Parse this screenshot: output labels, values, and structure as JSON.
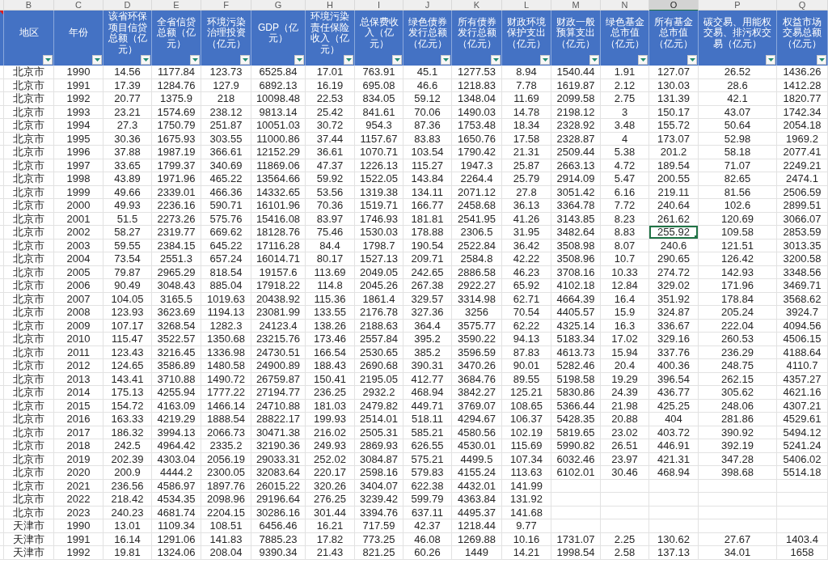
{
  "table": {
    "partial_column": {
      "comment": true
    },
    "columns": [
      {
        "letter": "B",
        "header": "地区",
        "selected": false
      },
      {
        "letter": "C",
        "header": "年份",
        "selected": false
      },
      {
        "letter": "D",
        "header": "该省环保项目信贷总额（亿元）",
        "selected": false
      },
      {
        "letter": "E",
        "header": "全省信贷总额（亿元）",
        "selected": false
      },
      {
        "letter": "F",
        "header": "环境污染治理投资（亿元）",
        "selected": false
      },
      {
        "letter": "G",
        "header": "GDP（亿元）",
        "selected": false
      },
      {
        "letter": "H",
        "header": "环境污染责任保险收入（亿元）",
        "selected": false
      },
      {
        "letter": "I",
        "header": "总保费收入（亿元）",
        "selected": false
      },
      {
        "letter": "J",
        "header": "绿色债券发行总额（亿元）",
        "selected": false
      },
      {
        "letter": "K",
        "header": "所有债券发行总额（亿元）",
        "selected": false
      },
      {
        "letter": "L",
        "header": "财政环境保护支出（亿元）",
        "selected": false
      },
      {
        "letter": "M",
        "header": "财政一般预算支出（亿元）",
        "selected": false
      },
      {
        "letter": "N",
        "header": "绿色基金总市值（亿元）",
        "selected": false
      },
      {
        "letter": "O",
        "header": "所有基金总市值（亿元）",
        "selected": true
      },
      {
        "letter": "P",
        "header": "碳交易、用能权交易、排污权交易（亿元）",
        "selected": false
      },
      {
        "letter": "Q",
        "header": "权益市场交易总额（亿元）",
        "selected": false
      }
    ],
    "rows": [
      {
        "selected": false,
        "cells": [
          "北京市",
          "1990",
          "14.56",
          "1177.84",
          "123.73",
          "6525.84",
          "17.01",
          "763.91",
          "45.1",
          "1277.53",
          "8.94",
          "1540.44",
          "1.91",
          "127.07",
          "26.52",
          "1436.26"
        ]
      },
      {
        "selected": false,
        "cells": [
          "北京市",
          "1991",
          "17.39",
          "1284.76",
          "127.9",
          "6892.13",
          "16.19",
          "695.08",
          "46.6",
          "1218.83",
          "7.78",
          "1619.87",
          "2.12",
          "130.03",
          "28.6",
          "1412.28"
        ]
      },
      {
        "selected": false,
        "cells": [
          "北京市",
          "1992",
          "20.77",
          "1375.9",
          "218",
          "10098.48",
          "22.53",
          "834.05",
          "59.12",
          "1348.04",
          "11.69",
          "2099.58",
          "2.75",
          "131.39",
          "42.1",
          "1820.77"
        ]
      },
      {
        "selected": false,
        "cells": [
          "北京市",
          "1993",
          "23.21",
          "1574.69",
          "238.12",
          "9813.14",
          "25.42",
          "841.61",
          "70.06",
          "1490.03",
          "14.78",
          "2198.12",
          "3",
          "150.17",
          "43.07",
          "1742.34"
        ]
      },
      {
        "selected": false,
        "cells": [
          "北京市",
          "1994",
          "27.3",
          "1750.79",
          "251.87",
          "10051.03",
          "30.72",
          "954.3",
          "87.36",
          "1753.48",
          "18.34",
          "2328.92",
          "3.48",
          "155.72",
          "50.64",
          "2054.18"
        ]
      },
      {
        "selected": false,
        "cells": [
          "北京市",
          "1995",
          "30.36",
          "1675.93",
          "303.55",
          "11000.86",
          "37.44",
          "1157.67",
          "83.83",
          "1650.76",
          "17.58",
          "2328.87",
          "4",
          "173.07",
          "52.98",
          "1969.2"
        ]
      },
      {
        "selected": false,
        "cells": [
          "北京市",
          "1996",
          "37.88",
          "1987.19",
          "366.61",
          "12152.29",
          "36.61",
          "1070.71",
          "103.54",
          "1790.42",
          "21.31",
          "2509.44",
          "5.38",
          "201.2",
          "58.18",
          "2077.41"
        ]
      },
      {
        "selected": false,
        "cells": [
          "北京市",
          "1997",
          "33.65",
          "1799.37",
          "340.69",
          "11869.06",
          "47.37",
          "1226.13",
          "115.27",
          "1947.3",
          "25.87",
          "2663.13",
          "4.72",
          "189.54",
          "71.07",
          "2249.21"
        ]
      },
      {
        "selected": false,
        "cells": [
          "北京市",
          "1998",
          "43.89",
          "1971.96",
          "465.22",
          "13564.66",
          "59.92",
          "1522.05",
          "143.84",
          "2264.4",
          "25.79",
          "2914.09",
          "5.47",
          "200.55",
          "82.65",
          "2474.1"
        ]
      },
      {
        "selected": false,
        "cells": [
          "北京市",
          "1999",
          "49.66",
          "2339.01",
          "466.36",
          "14332.65",
          "53.56",
          "1319.38",
          "134.11",
          "2071.12",
          "27.8",
          "3051.42",
          "6.16",
          "219.11",
          "81.56",
          "2506.59"
        ]
      },
      {
        "selected": false,
        "cells": [
          "北京市",
          "2000",
          "49.93",
          "2236.16",
          "590.71",
          "16101.96",
          "70.36",
          "1519.71",
          "166.77",
          "2458.68",
          "36.13",
          "3364.78",
          "7.72",
          "240.64",
          "102.6",
          "2899.51"
        ]
      },
      {
        "selected": false,
        "cells": [
          "北京市",
          "2001",
          "51.5",
          "2273.26",
          "575.76",
          "15416.08",
          "83.97",
          "1746.93",
          "181.81",
          "2541.95",
          "41.26",
          "3143.85",
          "8.23",
          "261.62",
          "120.69",
          "3066.07"
        ]
      },
      {
        "selected": true,
        "cells": [
          "北京市",
          "2002",
          "58.27",
          "2319.77",
          "669.62",
          "18128.76",
          "75.46",
          "1530.03",
          "178.88",
          "2306.5",
          "31.95",
          "3482.64",
          "8.83",
          "255.92",
          "109.58",
          "2853.59"
        ]
      },
      {
        "selected": false,
        "cells": [
          "北京市",
          "2003",
          "59.55",
          "2384.15",
          "645.22",
          "17116.28",
          "84.4",
          "1798.7",
          "190.54",
          "2522.84",
          "36.42",
          "3508.98",
          "8.07",
          "240.6",
          "121.51",
          "3013.35"
        ]
      },
      {
        "selected": false,
        "cells": [
          "北京市",
          "2004",
          "73.54",
          "2551.3",
          "657.24",
          "16014.71",
          "80.17",
          "1527.13",
          "209.71",
          "2584.8",
          "42.22",
          "3508.96",
          "10.7",
          "290.65",
          "126.42",
          "3200.58"
        ]
      },
      {
        "selected": false,
        "cells": [
          "北京市",
          "2005",
          "79.87",
          "2965.29",
          "818.54",
          "19157.6",
          "113.69",
          "2049.05",
          "242.65",
          "2886.58",
          "46.23",
          "3708.16",
          "10.33",
          "274.72",
          "142.93",
          "3348.56"
        ]
      },
      {
        "selected": false,
        "cells": [
          "北京市",
          "2006",
          "90.49",
          "3048.43",
          "885.04",
          "17918.22",
          "114.8",
          "2045.26",
          "267.38",
          "2922.27",
          "65.92",
          "4102.18",
          "12.84",
          "329.02",
          "171.96",
          "3469.71"
        ]
      },
      {
        "selected": false,
        "cells": [
          "北京市",
          "2007",
          "104.05",
          "3165.5",
          "1019.63",
          "20438.92",
          "115.36",
          "1861.4",
          "329.57",
          "3314.98",
          "62.71",
          "4664.39",
          "16.4",
          "351.92",
          "178.84",
          "3568.62"
        ]
      },
      {
        "selected": false,
        "cells": [
          "北京市",
          "2008",
          "123.93",
          "3623.69",
          "1194.13",
          "23081.99",
          "133.55",
          "2176.78",
          "327.36",
          "3256",
          "70.54",
          "4405.57",
          "15.9",
          "324.87",
          "205.24",
          "3924.7"
        ]
      },
      {
        "selected": false,
        "cells": [
          "北京市",
          "2009",
          "107.17",
          "3268.54",
          "1282.3",
          "24123.4",
          "138.26",
          "2188.63",
          "364.4",
          "3575.77",
          "62.22",
          "4325.14",
          "16.3",
          "336.67",
          "222.04",
          "4094.56"
        ]
      },
      {
        "selected": false,
        "cells": [
          "北京市",
          "2010",
          "115.47",
          "3522.57",
          "1350.68",
          "23215.76",
          "173.46",
          "2557.84",
          "395.2",
          "3590.22",
          "94.13",
          "5183.34",
          "17.02",
          "329.16",
          "260.53",
          "4506.15"
        ]
      },
      {
        "selected": false,
        "cells": [
          "北京市",
          "2011",
          "123.43",
          "3216.45",
          "1336.98",
          "24730.51",
          "166.54",
          "2530.65",
          "385.2",
          "3596.59",
          "87.83",
          "4613.73",
          "15.94",
          "337.76",
          "236.29",
          "4188.64"
        ]
      },
      {
        "selected": false,
        "cells": [
          "北京市",
          "2012",
          "124.65",
          "3586.89",
          "1480.58",
          "24900.89",
          "188.43",
          "2690.68",
          "390.31",
          "3470.26",
          "90.01",
          "5282.46",
          "20.4",
          "400.36",
          "248.75",
          "4110.7"
        ]
      },
      {
        "selected": false,
        "cells": [
          "北京市",
          "2013",
          "143.41",
          "3710.88",
          "1490.72",
          "26759.87",
          "150.41",
          "2195.05",
          "412.77",
          "3684.76",
          "89.55",
          "5198.58",
          "19.29",
          "396.54",
          "262.15",
          "4357.27"
        ]
      },
      {
        "selected": false,
        "cells": [
          "北京市",
          "2014",
          "175.13",
          "4255.94",
          "1777.22",
          "27194.77",
          "236.25",
          "2932.2",
          "468.94",
          "3842.27",
          "125.21",
          "5830.86",
          "24.39",
          "436.77",
          "305.62",
          "4621.16"
        ]
      },
      {
        "selected": false,
        "cells": [
          "北京市",
          "2015",
          "154.72",
          "4163.09",
          "1466.14",
          "24710.88",
          "181.03",
          "2479.82",
          "449.71",
          "3769.07",
          "108.65",
          "5366.44",
          "21.98",
          "425.25",
          "248.06",
          "4307.21"
        ]
      },
      {
        "selected": false,
        "cells": [
          "北京市",
          "2016",
          "163.33",
          "4219.29",
          "1888.54",
          "28822.17",
          "199.93",
          "2514.01",
          "518.11",
          "4294.67",
          "106.37",
          "5428.35",
          "20.88",
          "404",
          "281.86",
          "4529.61"
        ]
      },
      {
        "selected": false,
        "cells": [
          "北京市",
          "2017",
          "186.32",
          "3994.13",
          "2066.73",
          "30471.38",
          "216.02",
          "2505.31",
          "585.21",
          "4580.56",
          "102.19",
          "5819.65",
          "23.02",
          "403.72",
          "390.92",
          "5494.12"
        ]
      },
      {
        "selected": false,
        "cells": [
          "北京市",
          "2018",
          "242.5",
          "4964.42",
          "2335.2",
          "32190.36",
          "249.93",
          "2869.93",
          "626.55",
          "4530.01",
          "115.69",
          "5990.82",
          "26.51",
          "446.91",
          "392.19",
          "5241.24"
        ]
      },
      {
        "selected": false,
        "cells": [
          "北京市",
          "2019",
          "202.39",
          "4303.04",
          "2056.19",
          "29033.31",
          "252.02",
          "3084.87",
          "575.21",
          "4499.5",
          "107.34",
          "6032.46",
          "23.97",
          "421.31",
          "347.28",
          "5406.02"
        ]
      },
      {
        "selected": false,
        "cells": [
          "北京市",
          "2020",
          "200.9",
          "4444.2",
          "2300.05",
          "32083.64",
          "220.17",
          "2598.16",
          "579.83",
          "4155.24",
          "113.63",
          "6102.01",
          "30.46",
          "468.94",
          "398.68",
          "5514.18"
        ]
      },
      {
        "selected": false,
        "cells": [
          "北京市",
          "2021",
          "236.56",
          "4586.97",
          "1897.76",
          "26015.22",
          "320.26",
          "3404.07",
          "622.38",
          "4432.01",
          "141.99",
          null,
          null,
          null,
          null,
          null
        ]
      },
      {
        "selected": false,
        "cells": [
          "北京市",
          "2022",
          "218.42",
          "4534.35",
          "2098.96",
          "29196.64",
          "276.25",
          "3239.42",
          "599.79",
          "4363.84",
          "131.92",
          null,
          null,
          null,
          null,
          null
        ]
      },
      {
        "selected": false,
        "cells": [
          "北京市",
          "2023",
          "240.23",
          "4681.74",
          "2204.15",
          "30286.16",
          "301.44",
          "3394.76",
          "637.11",
          "4495.37",
          "141.68",
          null,
          null,
          null,
          null,
          null
        ]
      },
      {
        "selected": false,
        "cells": [
          "天津市",
          "1990",
          "13.01",
          "1109.34",
          "108.51",
          "6456.46",
          "16.21",
          "717.59",
          "42.37",
          "1218.44",
          "9.77",
          null,
          null,
          null,
          null,
          null
        ]
      },
      {
        "selected": false,
        "cells": [
          "天津市",
          "1991",
          "16.14",
          "1291.06",
          "141.83",
          "7885.23",
          "17.82",
          "773.25",
          "46.08",
          "1269.88",
          "10.16",
          "1731.07",
          "2.25",
          "130.62",
          "27.67",
          "1403.4"
        ]
      },
      {
        "selected": false,
        "cells": [
          "天津市",
          "1992",
          "19.81",
          "1324.06",
          "208.04",
          "9390.34",
          "21.43",
          "821.25",
          "60.26",
          "1449",
          "14.21",
          "1998.54",
          "2.58",
          "137.13",
          "34.01",
          "1658"
        ]
      }
    ]
  }
}
